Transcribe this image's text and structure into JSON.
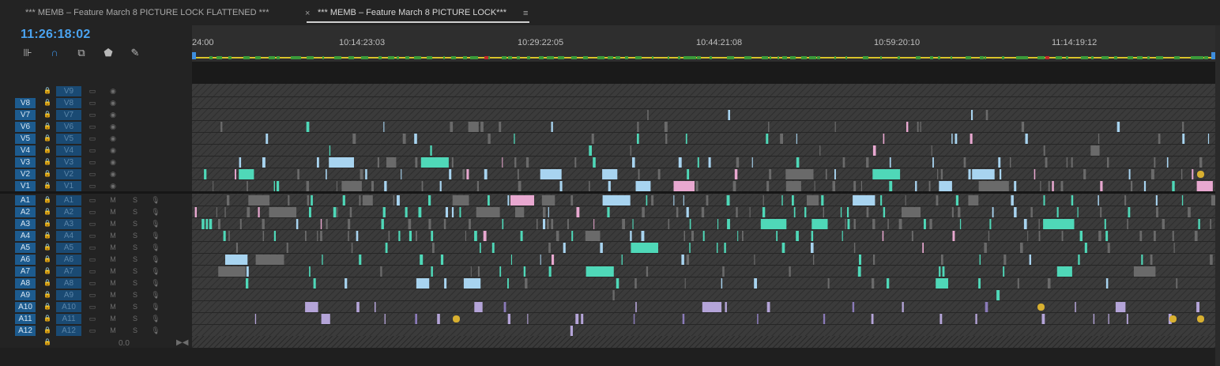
{
  "tabs": [
    {
      "label": "*** MEMB – Feature March 8 PICTURE LOCK FLATTENED ***",
      "active": false
    },
    {
      "label": "*** MEMB – Feature March 8 PICTURE LOCK***",
      "active": true
    }
  ],
  "tab_close_glyph": "×",
  "tab_menu_glyph": "≡",
  "timecode": "11:26:18:02",
  "tools": [
    {
      "name": "insert-edit-icon",
      "glyph": "⊪"
    },
    {
      "name": "snap-magnet-icon",
      "glyph": "∩"
    },
    {
      "name": "linked-selection-icon",
      "glyph": "⧉"
    },
    {
      "name": "add-marker-icon",
      "glyph": "⬟"
    },
    {
      "name": "timeline-settings-wrench-icon",
      "glyph": "✎"
    }
  ],
  "ruler": {
    "labels": [
      "24:00",
      "10:14:23:03",
      "10:29:22:05",
      "10:44:21:08",
      "10:59:20:10",
      "11:14:19:12"
    ]
  },
  "video_tracks": [
    {
      "target": "",
      "source": "V9"
    },
    {
      "target": "V8",
      "source": "V8"
    },
    {
      "target": "V7",
      "source": "V7"
    },
    {
      "target": "V6",
      "source": "V6"
    },
    {
      "target": "V5",
      "source": "V5"
    },
    {
      "target": "V4",
      "source": "V4"
    },
    {
      "target": "V3",
      "source": "V3"
    },
    {
      "target": "V2",
      "source": "V2"
    },
    {
      "target": "V1",
      "source": "V1"
    }
  ],
  "audio_tracks": [
    {
      "target": "A1",
      "source": "A1"
    },
    {
      "target": "A2",
      "source": "A2"
    },
    {
      "target": "A3",
      "source": "A3"
    },
    {
      "target": "A4",
      "source": "A4"
    },
    {
      "target": "A5",
      "source": "A5"
    },
    {
      "target": "A6",
      "source": "A6"
    },
    {
      "target": "A7",
      "source": "A7"
    },
    {
      "target": "A8",
      "source": "A8"
    },
    {
      "target": "A9",
      "source": "A9"
    },
    {
      "target": "A10",
      "source": "A10"
    },
    {
      "target": "A11",
      "source": "A11"
    },
    {
      "target": "A12",
      "source": "A12"
    }
  ],
  "audio_buttons": {
    "mute": "M",
    "solo": "S"
  },
  "master_volume": "0.0",
  "colors": {
    "accent_blue": "#3e8ede",
    "timecode_blue": "#4aa3f0",
    "clip_light_blue": "#a8d4f0",
    "clip_teal": "#4fd8b8",
    "clip_pink": "#e8a8d0",
    "clip_lavender": "#b4a4d8",
    "clip_lavender_dark": "#8a7ab8",
    "ruler_yellow": "#d8c22a",
    "ruler_green": "#3a9a3a",
    "ruler_red": "#c02a2a",
    "fx_badge": "#d8b030"
  }
}
